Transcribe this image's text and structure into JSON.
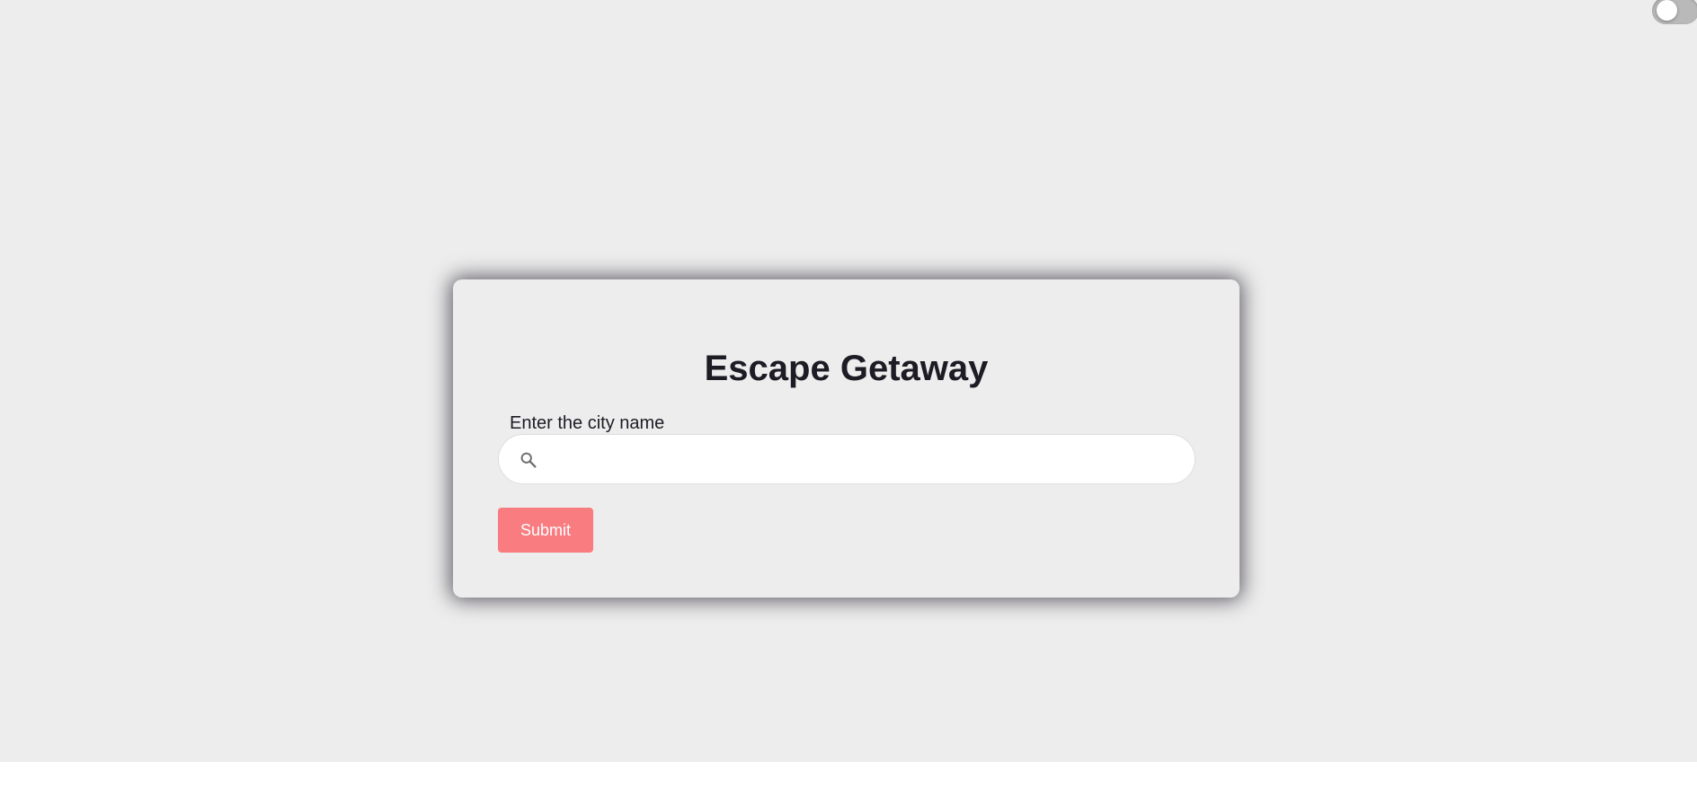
{
  "theme_toggle": {
    "state": "off"
  },
  "card": {
    "title": "Escape Getaway",
    "city_label": "Enter the city name",
    "search": {
      "value": "",
      "placeholder": "",
      "icon": "search-icon"
    },
    "submit_label": "Submit"
  },
  "colors": {
    "background": "#ededed",
    "card": "#ededed",
    "accent": "#f87c80",
    "text": "#1d1b24"
  }
}
